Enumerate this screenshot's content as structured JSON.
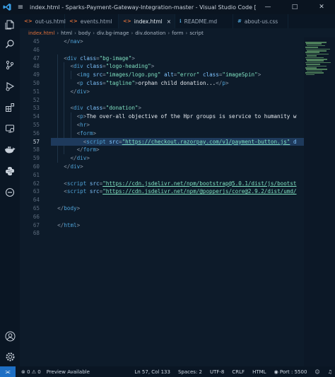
{
  "window": {
    "title": "index.html - Sparks-Payment-Gateway-Integration-master - Visual Studio Code [Adm...",
    "controls": [
      "—",
      "□",
      "✕"
    ]
  },
  "tabs": [
    {
      "label": "out-us.html",
      "icon": "<>",
      "type": "html"
    },
    {
      "label": "events.html",
      "icon": "<>",
      "type": "html"
    },
    {
      "label": "index.html",
      "icon": "<>",
      "type": "html",
      "active": true,
      "close": "×"
    },
    {
      "label": "README.md",
      "icon": "ℹ",
      "type": "md"
    },
    {
      "label": "about-us.css",
      "icon": "#",
      "type": "css"
    }
  ],
  "breadcrumb": [
    "index.html",
    "html",
    "body",
    "div.bg-image",
    "div.donation",
    "form",
    "script"
  ],
  "editor": {
    "current_line": "57",
    "lines": [
      {
        "n": "45",
        "code": "    </nav>"
      },
      {
        "n": "46",
        "code": ""
      },
      {
        "n": "47",
        "code": "    <div class=\"bg-image\">"
      },
      {
        "n": "48",
        "code": "      <div class=\"logo-heading\">"
      },
      {
        "n": "49",
        "code": "        <img src=\"images/logo.png\" alt=\"error\" class=\"imageSpin\">"
      },
      {
        "n": "50",
        "code": "        <p class=\"tagline\">orphan child donation...</p>"
      },
      {
        "n": "51",
        "code": "      </div>"
      },
      {
        "n": "52",
        "code": ""
      },
      {
        "n": "53",
        "code": "      <div class=\"donation\">"
      },
      {
        "n": "54",
        "code": "        <p>The over-all objective of the Hpr groups is service to humanity w"
      },
      {
        "n": "55",
        "code": "        <hr>"
      },
      {
        "n": "56",
        "code": "        <form>"
      },
      {
        "n": "57",
        "code": "          <script src=\"https://checkout.razorpay.com/v1/payment-button.js\" d"
      },
      {
        "n": "58",
        "code": "        </form>"
      },
      {
        "n": "59",
        "code": "      </div>"
      },
      {
        "n": "60",
        "code": "    </div>"
      },
      {
        "n": "61",
        "code": ""
      },
      {
        "n": "62",
        "code": "    <script src=\"https://cdn.jsdelivr.net/npm/bootstrap@5.0.1/dist/js/bootst"
      },
      {
        "n": "63",
        "code": "    <script src=\"https://cdn.jsdelivr.net/npm/@popperjs/core@2.9.2/dist/umd/"
      },
      {
        "n": "64",
        "code": ""
      },
      {
        "n": "65",
        "code": "  </body>"
      },
      {
        "n": "66",
        "code": ""
      },
      {
        "n": "67",
        "code": "  </html>"
      },
      {
        "n": "68",
        "code": ""
      }
    ]
  },
  "statusbar": {
    "remote_icon": "⫘",
    "problems": "⊗ 0 ⚠ 0",
    "preview": "Preview Available",
    "position": "Ln 57, Col 133",
    "spaces": "Spaces: 2",
    "encoding": "UTF-8",
    "eol": "CRLF",
    "language": "HTML",
    "port": "◉ Port : 5500",
    "feedback_icon": "☺",
    "bell_icon": "♫"
  },
  "colors": {
    "background": "#0d1b2a",
    "tag": "#4fa3d8",
    "attribute": "#7fc4ff",
    "string": "#7fe0c0",
    "selection": "#1e3a5c",
    "status_remote": "#1e6fc4"
  }
}
